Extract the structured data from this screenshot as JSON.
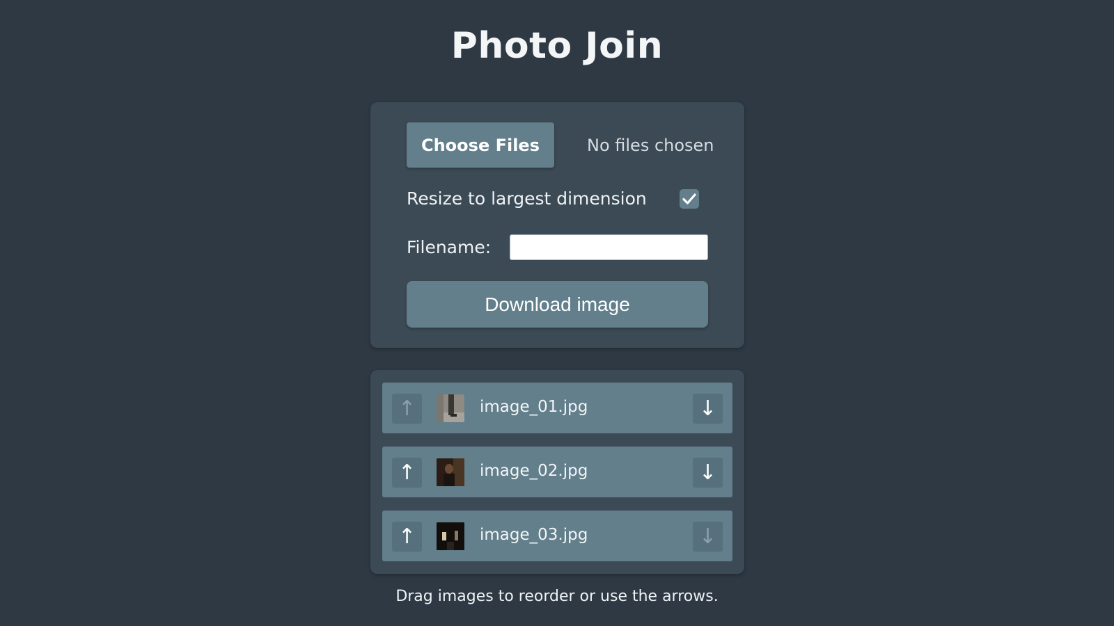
{
  "app": {
    "title": "Photo Join"
  },
  "controls": {
    "choose_files_label": "Choose Files",
    "no_files_text": "No files chosen",
    "resize_label": "Resize to largest dimension",
    "resize_checked": true,
    "filename_label": "Filename:",
    "filename_value": "",
    "download_label": "Download image"
  },
  "images": [
    {
      "name": "image_01.jpg",
      "up_enabled": false,
      "down_enabled": true,
      "thumb_icon": "photo-thumbnail"
    },
    {
      "name": "image_02.jpg",
      "up_enabled": true,
      "down_enabled": true,
      "thumb_icon": "photo-thumbnail"
    },
    {
      "name": "image_03.jpg",
      "up_enabled": true,
      "down_enabled": false,
      "thumb_icon": "photo-thumbnail"
    }
  ],
  "arrows": {
    "up": "↑",
    "down": "↓"
  },
  "hint": "Drag images to reorder or use the arrows.",
  "colors": {
    "background": "#2e3944",
    "panel": "#3c4a56",
    "accent": "#627f8b",
    "arrow_button": "#56707d"
  }
}
